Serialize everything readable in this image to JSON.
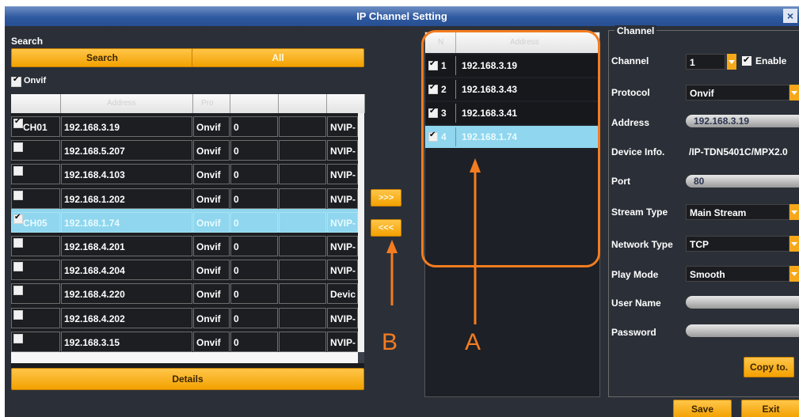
{
  "window": {
    "title": "IP Channel Setting",
    "close_glyph": "×"
  },
  "search": {
    "section_label": "Search",
    "search_button": "Search",
    "all_button": "All",
    "onvif_label": "Onvif",
    "onvif_checked": true,
    "columns": [
      "",
      "Address",
      "Pro",
      "",
      "",
      ""
    ],
    "rows": [
      {
        "checked": true,
        "ch": "CH01",
        "address": "192.168.3.19",
        "protocol": "Onvif",
        "num": "0",
        "extra": "",
        "type": "NVIP-",
        "selected": false
      },
      {
        "checked": false,
        "ch": "",
        "address": "192.168.5.207",
        "protocol": "Onvif",
        "num": "0",
        "extra": "",
        "type": "NVIP-",
        "selected": false
      },
      {
        "checked": false,
        "ch": "",
        "address": "192.168.4.103",
        "protocol": "Onvif",
        "num": "0",
        "extra": "",
        "type": "NVIP-",
        "selected": false
      },
      {
        "checked": false,
        "ch": "",
        "address": "192.168.1.202",
        "protocol": "Onvif",
        "num": "0",
        "extra": "",
        "type": "NVIP-",
        "selected": false
      },
      {
        "checked": true,
        "ch": "CH05",
        "address": "192.168.1.74",
        "protocol": "Onvif",
        "num": "0",
        "extra": "",
        "type": "NVIP-",
        "selected": true
      },
      {
        "checked": false,
        "ch": "",
        "address": "192.168.4.201",
        "protocol": "Onvif",
        "num": "0",
        "extra": "",
        "type": "NVIP-",
        "selected": false
      },
      {
        "checked": false,
        "ch": "",
        "address": "192.168.4.204",
        "protocol": "Onvif",
        "num": "0",
        "extra": "",
        "type": "NVIP-",
        "selected": false
      },
      {
        "checked": false,
        "ch": "",
        "address": "192.168.4.220",
        "protocol": "Onvif",
        "num": "0",
        "extra": "",
        "type": "Devic",
        "selected": false
      },
      {
        "checked": false,
        "ch": "",
        "address": "192.168.4.202",
        "protocol": "Onvif",
        "num": "0",
        "extra": "",
        "type": "NVIP-",
        "selected": false
      },
      {
        "checked": false,
        "ch": "",
        "address": "192.168.3.15",
        "protocol": "Onvif",
        "num": "0",
        "extra": "",
        "type": "NVIP-",
        "selected": false
      }
    ],
    "details_button": "Details"
  },
  "transfer": {
    "add_button": ">>>",
    "remove_button": "<<<"
  },
  "channel_list": {
    "columns": [
      "N",
      "Address"
    ],
    "rows": [
      {
        "checked": true,
        "num": "1",
        "address": "192.168.3.19",
        "selected": false
      },
      {
        "checked": true,
        "num": "2",
        "address": "192.168.3.43",
        "selected": false
      },
      {
        "checked": true,
        "num": "3",
        "address": "192.168.3.41",
        "selected": false
      },
      {
        "checked": true,
        "num": "4",
        "address": "192.168.1.74",
        "selected": true
      }
    ]
  },
  "channel": {
    "section_label": "Channel",
    "channel_label": "Channel",
    "channel_value": "1",
    "enable_label": "Enable",
    "enable_checked": true,
    "protocol_label": "Protocol",
    "protocol_value": "Onvif",
    "address_label": "Address",
    "address_value": "192.168.3.19",
    "device_info_label": "Device Info.",
    "device_info_value": "/IP-TDN5401C/MPX2.0",
    "port_label": "Port",
    "port_value": "80",
    "stream_type_label": "Stream Type",
    "stream_type_value": "Main Stream",
    "network_type_label": "Network Type",
    "network_type_value": "TCP",
    "play_mode_label": "Play Mode",
    "play_mode_value": "Smooth",
    "user_name_label": "User Name",
    "user_name_value": "",
    "password_label": "Password",
    "password_value": "",
    "copy_button": "Copy to.",
    "save_button": "Save",
    "exit_button": "Exit"
  },
  "annotations": {
    "label_a": "A",
    "label_b": "B",
    "accent": "#f47c20"
  }
}
